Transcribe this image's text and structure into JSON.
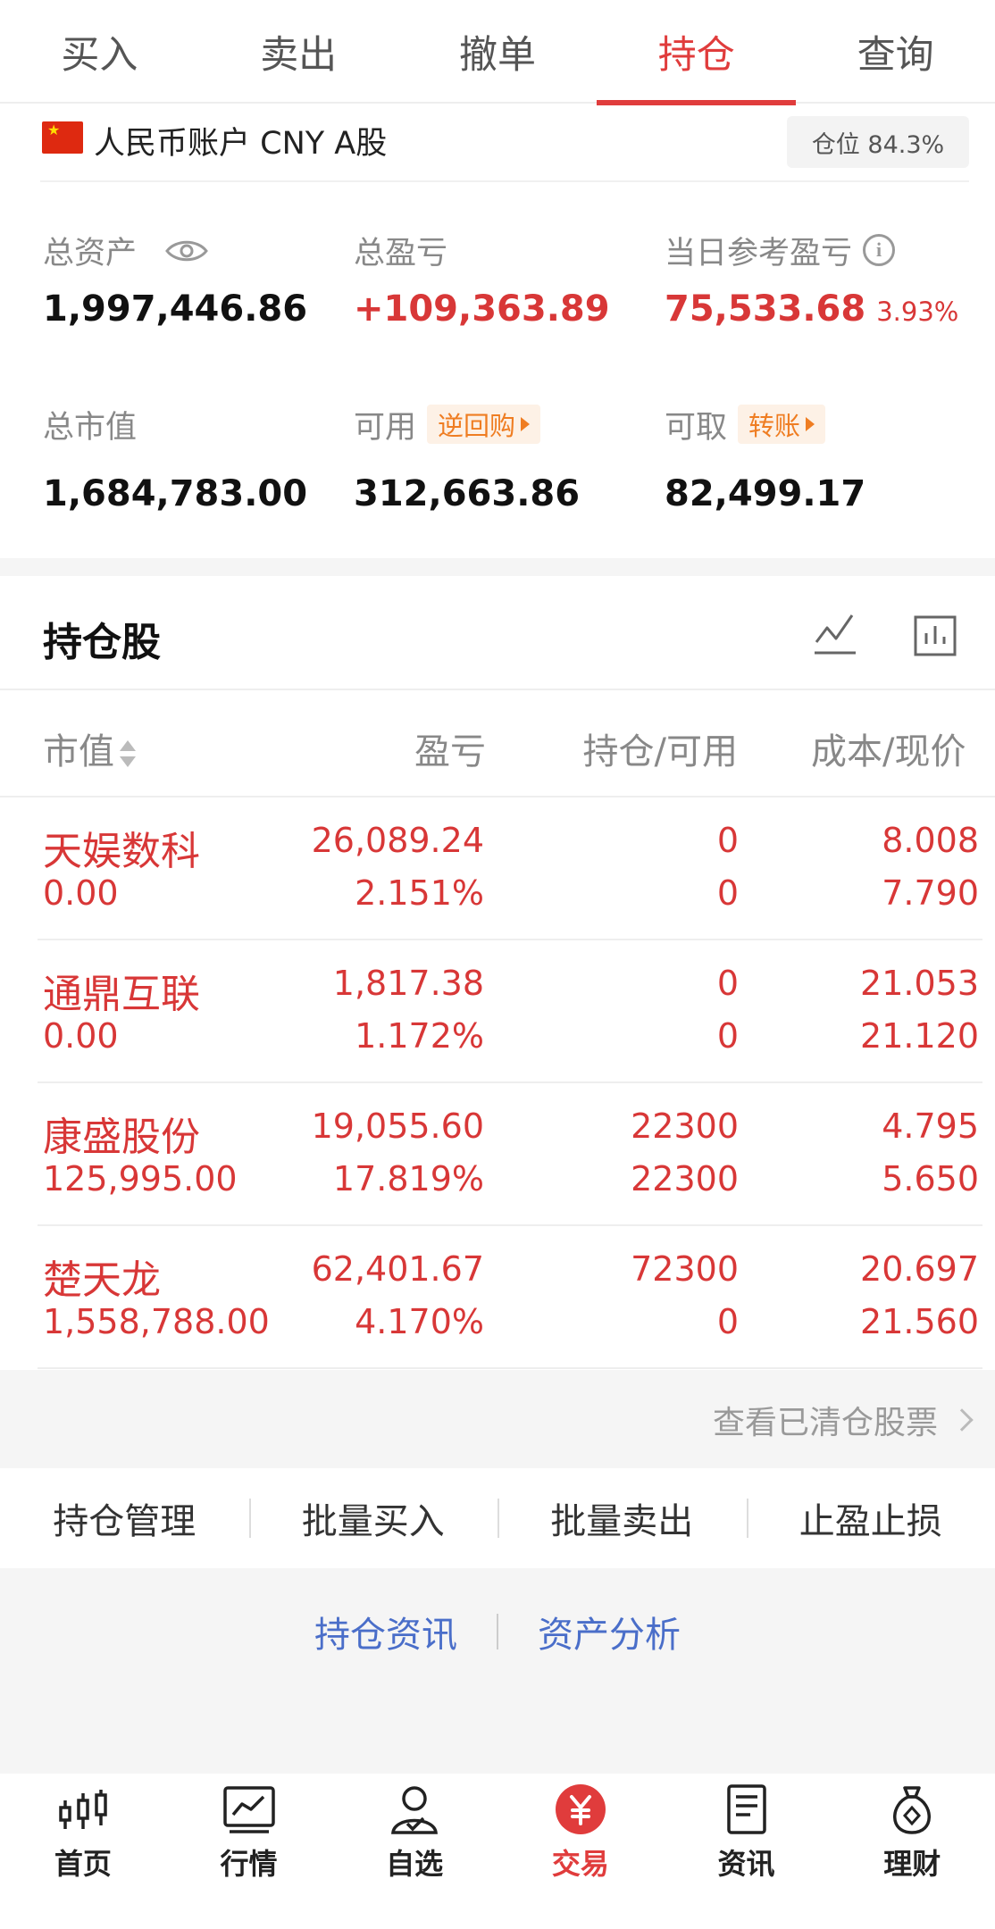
{
  "tabs": [
    "买入",
    "卖出",
    "撤单",
    "持仓",
    "查询"
  ],
  "active_tab": "持仓",
  "account": {
    "name": "人民币账户 CNY A股",
    "position_ratio": "仓位 84.3%"
  },
  "summary": {
    "total_assets_label": "总资产",
    "total_assets": "1,997,446.86",
    "total_pl_label": "总盈亏",
    "total_pl": "+109,363.89",
    "daily_pl_label": "当日参考盈亏",
    "daily_pl": "75,533.68",
    "daily_pl_pct": "3.93%",
    "market_value_label": "总市值",
    "market_value": "1,684,783.00",
    "available_label": "可用",
    "available_tag": "逆回购",
    "available": "312,663.86",
    "withdrawable_label": "可取",
    "withdrawable_tag": "转账",
    "withdrawable": "82,499.17"
  },
  "holdings": {
    "title": "持仓股",
    "columns": [
      "市值",
      "盈亏",
      "持仓/可用",
      "成本/现价"
    ],
    "rows": [
      {
        "name": "天娱数科",
        "market_value": "0.00",
        "pl": "26,089.24",
        "pl_pct": "2.151%",
        "holding": "0",
        "available": "0",
        "cost": "8.008",
        "price": "7.790"
      },
      {
        "name": "通鼎互联",
        "market_value": "0.00",
        "pl": "1,817.38",
        "pl_pct": "1.172%",
        "holding": "0",
        "available": "0",
        "cost": "21.053",
        "price": "21.120"
      },
      {
        "name": "康盛股份",
        "market_value": "125,995.00",
        "pl": "19,055.60",
        "pl_pct": "17.819%",
        "holding": "22300",
        "available": "22300",
        "cost": "4.795",
        "price": "5.650"
      },
      {
        "name": "楚天龙",
        "market_value": "1,558,788.00",
        "pl": "62,401.67",
        "pl_pct": "4.170%",
        "holding": "72300",
        "available": "0",
        "cost": "20.697",
        "price": "21.560"
      }
    ]
  },
  "cleared_link": "查看已清仓股票",
  "actions": [
    "持仓管理",
    "批量买入",
    "批量卖出",
    "止盈止损"
  ],
  "links": [
    "持仓资讯",
    "资产分析"
  ],
  "bottom_nav": [
    {
      "label": "首页",
      "icon": "candlestick-icon"
    },
    {
      "label": "行情",
      "icon": "market-chart-icon"
    },
    {
      "label": "自选",
      "icon": "user-check-icon"
    },
    {
      "label": "交易",
      "icon": "yuan-coin-icon"
    },
    {
      "label": "资讯",
      "icon": "document-icon"
    },
    {
      "label": "理财",
      "icon": "money-bag-icon"
    }
  ],
  "colors": {
    "accent": "#e03c3c",
    "profit": "#d83737",
    "tag": "#ef7d22",
    "link": "#4a6ec9"
  }
}
